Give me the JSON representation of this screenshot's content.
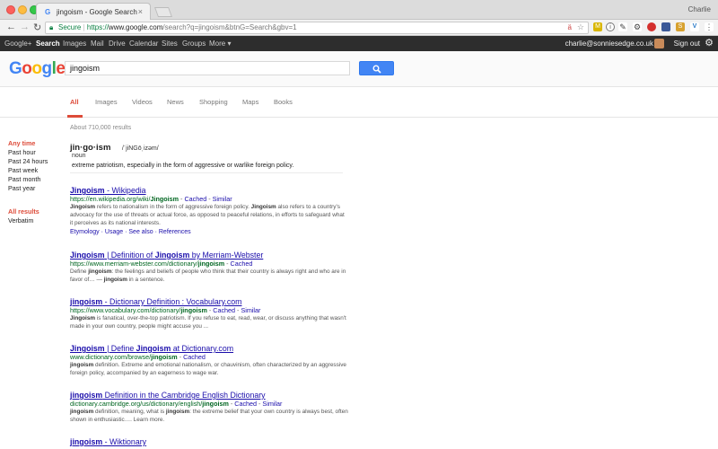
{
  "window": {
    "tab_title": "jingoism - Google Search",
    "tab_favicon": "G",
    "tab_close": "×",
    "user_name": "Charlie"
  },
  "toolbar": {
    "secure_label": "Secure",
    "url_scheme": "https://",
    "url_host": "www.google.com",
    "url_path": "/search?q=jingoism&btnG=Search&gbv=1",
    "back": "←",
    "forward": "→",
    "reload": "↻",
    "star": "☆",
    "extensions": [
      "M",
      "i",
      "S",
      "V"
    ]
  },
  "gbar": {
    "items": [
      "Google+",
      "Search",
      "Images",
      "Mail",
      "Drive",
      "Calendar",
      "Sites",
      "Groups",
      "More ▾"
    ],
    "active_index": 1,
    "email": "charlie@sonniesedge.co.uk",
    "sign_out": "Sign out",
    "settings_icon": "⚙"
  },
  "search": {
    "logo_letters": [
      {
        "ch": "G",
        "color": "#4285f4"
      },
      {
        "ch": "o",
        "color": "#ea4335"
      },
      {
        "ch": "o",
        "color": "#fbbc05"
      },
      {
        "ch": "g",
        "color": "#4285f4"
      },
      {
        "ch": "l",
        "color": "#34a853"
      },
      {
        "ch": "e",
        "color": "#ea4335"
      }
    ],
    "query": "jingoism",
    "button_icon": "search-icon"
  },
  "tabs": {
    "items": [
      "All",
      "Images",
      "Videos",
      "News",
      "Shopping",
      "Maps",
      "Books"
    ],
    "active_index": 0
  },
  "stats": "About 710,000 results",
  "leftnav": {
    "time": [
      "Any time",
      "Past hour",
      "Past 24 hours",
      "Past week",
      "Past month",
      "Past year"
    ],
    "results": [
      "All results",
      "Verbatim"
    ]
  },
  "dictionary": {
    "word": "jin·go·ism",
    "pronunciation": "/ˈjiNGōˌizəm/",
    "part_of_speech": "noun",
    "definition": "extreme patriotism, especially in the form of aggressive or warlike foreign policy."
  },
  "results": [
    {
      "title_parts": [
        [
          "Jingoism",
          true
        ],
        [
          " - Wikipedia",
          false
        ]
      ],
      "url_parts": [
        [
          "https://en.wikipedia.org/wiki/",
          false
        ],
        [
          "Jingoism",
          true
        ]
      ],
      "cached": "Cached",
      "similar": "Similar",
      "snippet_parts": [
        [
          "Jingoism",
          true
        ],
        [
          " refers to nationalism in the form of aggressive foreign policy. ",
          false
        ],
        [
          "Jingoism",
          true
        ],
        [
          " also refers to a country's advocacy for the use of threats or actual force, as opposed to peaceful relations, in efforts to safeguard what it perceives as its national interests.",
          false
        ]
      ],
      "links": [
        "Etymology",
        "Usage",
        "See also",
        "References"
      ]
    },
    {
      "title_parts": [
        [
          "Jingoism",
          true
        ],
        [
          " | Definition of ",
          false
        ],
        [
          "Jingoism",
          true
        ],
        [
          " by Merriam-Webster",
          false
        ]
      ],
      "url_parts": [
        [
          "https://www.merriam-webster.com/dictionary/",
          false
        ],
        [
          "jingoism",
          true
        ]
      ],
      "cached": "Cached",
      "similar": "",
      "snippet_parts": [
        [
          "Define ",
          false
        ],
        [
          "jingoism",
          true
        ],
        [
          ": the feelings and beliefs of people who think that their country is always right and who are in favor of… — ",
          false
        ],
        [
          "jingoism",
          true
        ],
        [
          " in a sentence.",
          false
        ]
      ],
      "links": []
    },
    {
      "title_parts": [
        [
          "jingoism",
          true
        ],
        [
          " - Dictionary Definition : Vocabulary.com",
          false
        ]
      ],
      "url_parts": [
        [
          "https://www.vocabulary.com/dictionary/",
          false
        ],
        [
          "jingoism",
          true
        ]
      ],
      "cached": "Cached",
      "similar": "Similar",
      "snippet_parts": [
        [
          "Jingoism",
          true
        ],
        [
          " is fanatical, over-the-top patriotism. If you refuse to eat, read, wear, or discuss anything that wasn't made in your own country, people might accuse you  ...",
          false
        ]
      ],
      "links": []
    },
    {
      "title_parts": [
        [
          "Jingoism",
          true
        ],
        [
          " | Define ",
          false
        ],
        [
          "Jingoism",
          true
        ],
        [
          " at Dictionary.com",
          false
        ]
      ],
      "url_parts": [
        [
          "www.dictionary.com/browse/",
          false
        ],
        [
          "jingoism",
          true
        ]
      ],
      "cached": "Cached",
      "similar": "",
      "snippet_parts": [
        [
          "jingoism",
          true
        ],
        [
          " definition. Extreme and emotional nationalism, or chauvinism, often characterized by an aggressive foreign policy, accompanied by an eagerness to wage war.",
          false
        ]
      ],
      "links": []
    },
    {
      "title_parts": [
        [
          "jingoism",
          true
        ],
        [
          " Definition in the Cambridge English Dictionary",
          false
        ]
      ],
      "url_parts": [
        [
          "dictionary.cambridge.org/us/dictionary/english/",
          false
        ],
        [
          "jingoism",
          true
        ]
      ],
      "cached": "Cached",
      "similar": "Similar",
      "snippet_parts": [
        [
          "jingoism",
          true
        ],
        [
          " definition, meaning, what is ",
          false
        ],
        [
          "jingoism",
          true
        ],
        [
          ": the extreme belief that your own country is always best, often shown in enthusiastic…. Learn more.",
          false
        ]
      ],
      "links": []
    },
    {
      "title_parts": [
        [
          "jingoism",
          true
        ],
        [
          " - Wiktionary",
          false
        ]
      ],
      "url_parts": [],
      "cached": "",
      "similar": "",
      "snippet_parts": [],
      "links": []
    }
  ]
}
